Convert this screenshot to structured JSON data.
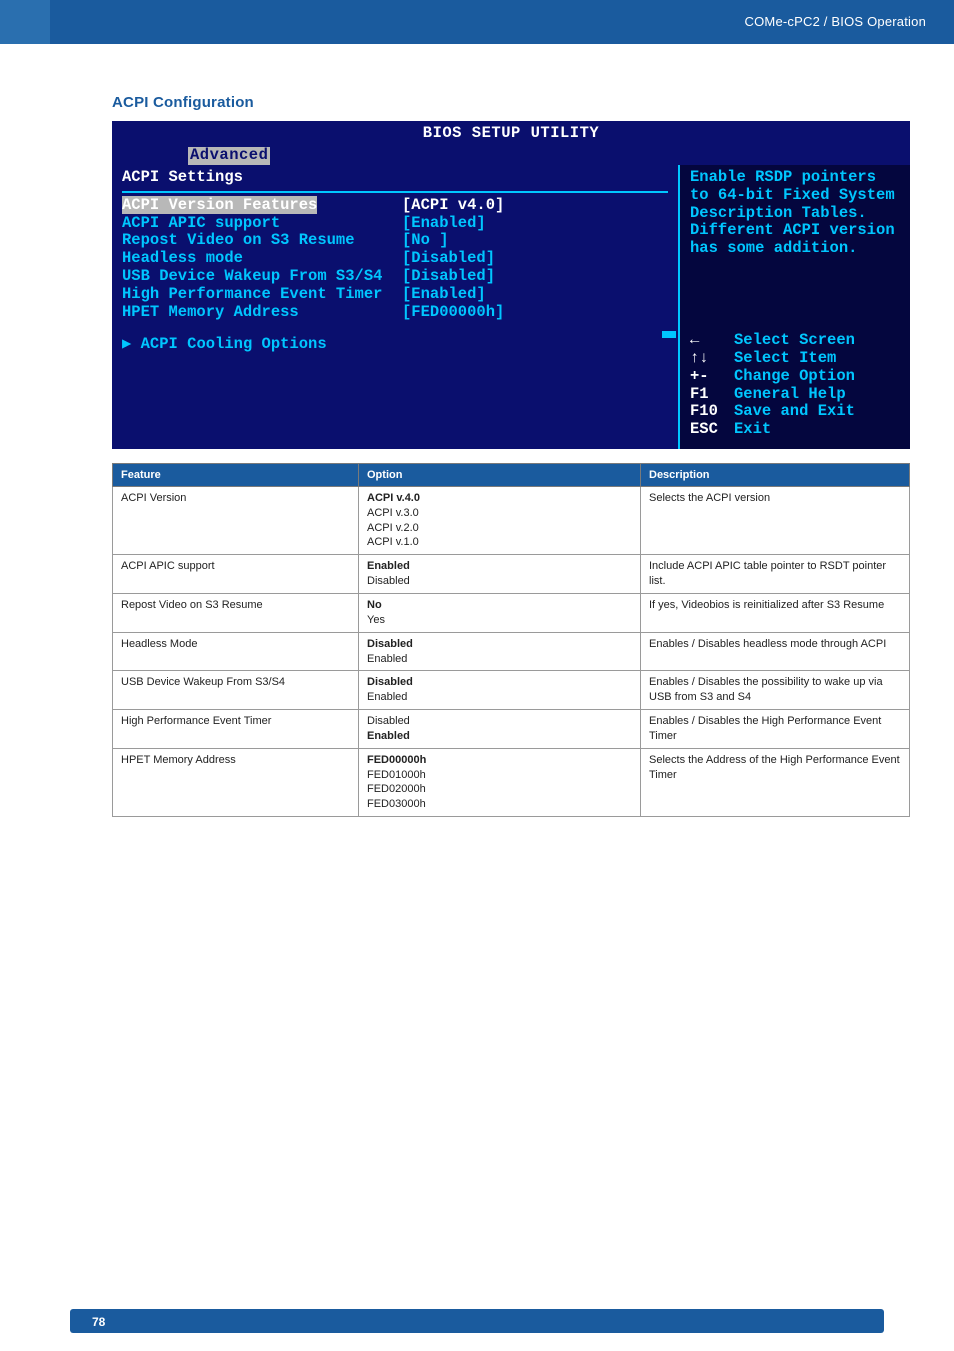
{
  "header": {
    "breadcrumb": "COMe-cPC2 / BIOS Operation"
  },
  "section": {
    "title": "ACPI Configuration"
  },
  "bios": {
    "title": "BIOS SETUP UTILITY",
    "tab": "Advanced",
    "panel_title": "ACPI Settings",
    "items": [
      {
        "label": "ACPI Version Features",
        "value": "[ACPI v4.0]",
        "selected": true
      },
      {
        "label": "ACPI APIC support",
        "value": "[Enabled]"
      },
      {
        "label": "Repost Video on S3 Resume",
        "value": "[No ]"
      },
      {
        "label": "Headless mode",
        "value": "[Disabled]"
      },
      {
        "label": "USB Device Wakeup From S3/S4",
        "value": "[Disabled]"
      },
      {
        "label": "High Performance Event Timer",
        "value": "[Enabled]"
      },
      {
        "label": "HPET Memory Address",
        "value": "[FED00000h]"
      }
    ],
    "submenu": "▶ ACPI Cooling Options",
    "help_text": "Enable RSDP pointers to 64-bit Fixed System Description Tables. Different ACPI version has some addition.",
    "nav": [
      {
        "key": "←",
        "label": "Select Screen"
      },
      {
        "key": "↑↓",
        "label": "Select Item"
      },
      {
        "key": "+-",
        "label": "Change Option"
      },
      {
        "key": "F1",
        "label": "General Help"
      },
      {
        "key": "F10",
        "label": "Save and Exit"
      },
      {
        "key": "ESC",
        "label": "Exit"
      }
    ]
  },
  "table": {
    "headers": {
      "feature": "Feature",
      "option": "Option",
      "description": "Description"
    },
    "rows": [
      {
        "feature": "ACPI Version",
        "option_bold": "ACPI v.4.0",
        "option_rest": "ACPI v.3.0\nACPI v.2.0\nACPI v.1.0",
        "description": "Selects the ACPI version"
      },
      {
        "feature": "ACPI APIC support",
        "option_bold": "Enabled",
        "option_rest": "Disabled",
        "description": "Include ACPI APIC table pointer to RSDT pointer list."
      },
      {
        "feature": "Repost Video on S3 Resume",
        "option_bold": "No",
        "option_rest": "Yes",
        "description": "If yes, Videobios is reinitialized after S3 Resume"
      },
      {
        "feature": "Headless Mode",
        "option_bold": "Disabled",
        "option_rest": "Enabled",
        "description": "Enables / Disables headless mode through ACPI"
      },
      {
        "feature": "USB Device Wakeup From S3/S4",
        "option_bold": "Disabled",
        "option_rest": "Enabled",
        "description": "Enables / Disables the possibility to wake up via USB from S3 and S4"
      },
      {
        "feature": "High Performance Event Timer",
        "option_rest_first": "Disabled",
        "option_bold": "Enabled",
        "description": "Enables / Disables the High Performance Event Timer"
      },
      {
        "feature": "HPET Memory Address",
        "option_bold": "FED00000h",
        "option_rest": "FED01000h\nFED02000h\nFED03000h",
        "description": "Selects the Address of the High Performance Event Timer"
      }
    ]
  },
  "footer": {
    "page": "78"
  }
}
